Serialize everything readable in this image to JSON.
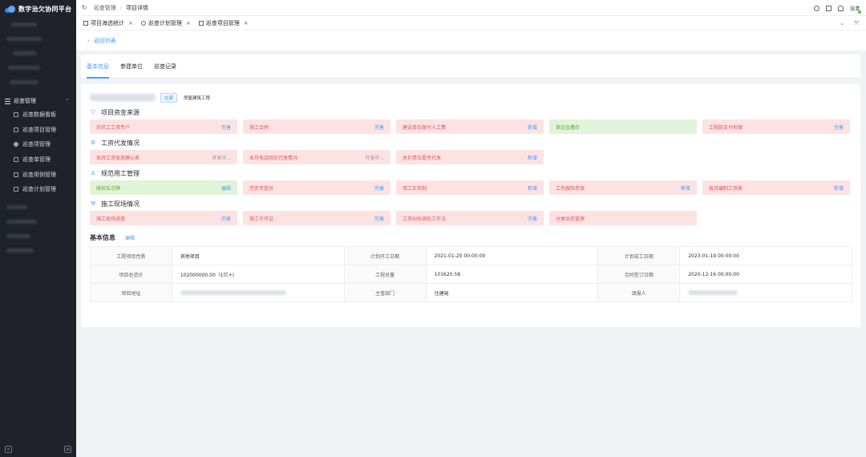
{
  "app": {
    "title": "数字治欠协同平台"
  },
  "sidebar": {
    "group": {
      "label": "巡查管理"
    },
    "items": [
      {
        "label": "巡查数据看板",
        "icon": "dashboard-icon"
      },
      {
        "label": "巡查项目管理",
        "icon": "grid-icon"
      },
      {
        "label": "巡查项管理",
        "icon": "gear-icon"
      },
      {
        "label": "巡查单管理",
        "icon": "stats-icon"
      },
      {
        "label": "巡查用例管理",
        "icon": "document-icon"
      },
      {
        "label": "巡查计划管理",
        "icon": "calendar-icon"
      }
    ],
    "collapse_glyph": "«",
    "menu_glyph": "≡"
  },
  "header": {
    "breadcrumb": [
      "巡查管理",
      "项目详情"
    ],
    "user": "张清"
  },
  "tags": [
    {
      "label": "项目海选统计",
      "icon": "chart-icon"
    },
    {
      "label": "巡查计划管理",
      "icon": "clock-icon"
    },
    {
      "label": "巡查项目管理",
      "icon": "grid-icon"
    }
  ],
  "back": {
    "label": "返回列表"
  },
  "tabs": [
    {
      "label": "基本信息",
      "active": true
    },
    {
      "label": "参建单位",
      "active": false
    },
    {
      "label": "巡查记录",
      "active": false
    }
  ],
  "project": {
    "status": "在建",
    "type": "房屋建筑工程"
  },
  "sections": [
    {
      "title": "项目资金来源",
      "cards": [
        {
          "label": "农民工工资专户",
          "action": "完善",
          "color": "red"
        },
        {
          "label": "施工合同",
          "action": "完善",
          "color": "red"
        },
        {
          "label": "建设单位拨付人工费",
          "action": "新增",
          "color": "red"
        },
        {
          "label": "保证金缴存",
          "action": "",
          "color": "green"
        },
        {
          "label": "工程款支付担保",
          "action": "完善",
          "color": "red"
        }
      ]
    },
    {
      "title": "工资代发情况",
      "cards": [
        {
          "label": "本月工资发放确认表",
          "action": "开发中...",
          "color": "red"
        },
        {
          "label": "本月电话回访代发情况",
          "action": "开发中...",
          "color": "red"
        },
        {
          "label": "总包单位提币代发",
          "action": "新增",
          "color": "red"
        }
      ]
    },
    {
      "title": "规范用工管理",
      "cards": [
        {
          "label": "维权告示牌",
          "action": "编辑",
          "color": "green"
        },
        {
          "label": "劳资专管员",
          "action": "完善",
          "color": "red"
        },
        {
          "label": "用工实名制",
          "action": "新增",
          "color": "red"
        },
        {
          "label": "工伤保险参保",
          "action": "新增",
          "color": "red"
        },
        {
          "label": "按月编制工资表",
          "action": "新增",
          "color": "red"
        }
      ]
    },
    {
      "title": "施工现场情况",
      "cards": [
        {
          "label": "施工现场进度",
          "action": "完善",
          "color": "red"
        },
        {
          "label": "施工许可证",
          "action": "完善",
          "color": "red"
        },
        {
          "label": "工资纠纷调处工作法",
          "action": "完善",
          "color": "red"
        },
        {
          "label": "分类动态管理",
          "action": "",
          "color": "red"
        }
      ]
    }
  ],
  "basic_info": {
    "title": "基本信息",
    "edit_label": "编辑",
    "rows": [
      [
        {
          "label": "工程项目性质",
          "value": "其他项目"
        },
        {
          "label": "计划开工日期",
          "value": "2021-01-20 00:00:00"
        },
        {
          "label": "计划竣工日期",
          "value": "2023-01-19 00:00:00"
        }
      ],
      [
        {
          "label": "项目总造价",
          "value": "102000000.00（1亿+)"
        },
        {
          "label": "工程总量",
          "value": "101620.58"
        },
        {
          "label": "合同签订日期",
          "value": "2020-12-16 00:00:00"
        }
      ],
      [
        {
          "label": "项目地址",
          "value": ""
        },
        {
          "label": "主管部门",
          "value": "住建局"
        },
        {
          "label": "填报人",
          "value": ""
        }
      ]
    ]
  },
  "colors": {
    "accent": "#409eff",
    "red_bg": "#fde2e2",
    "green_bg": "#e1f3d8",
    "sidebar_bg": "#1f2229"
  }
}
